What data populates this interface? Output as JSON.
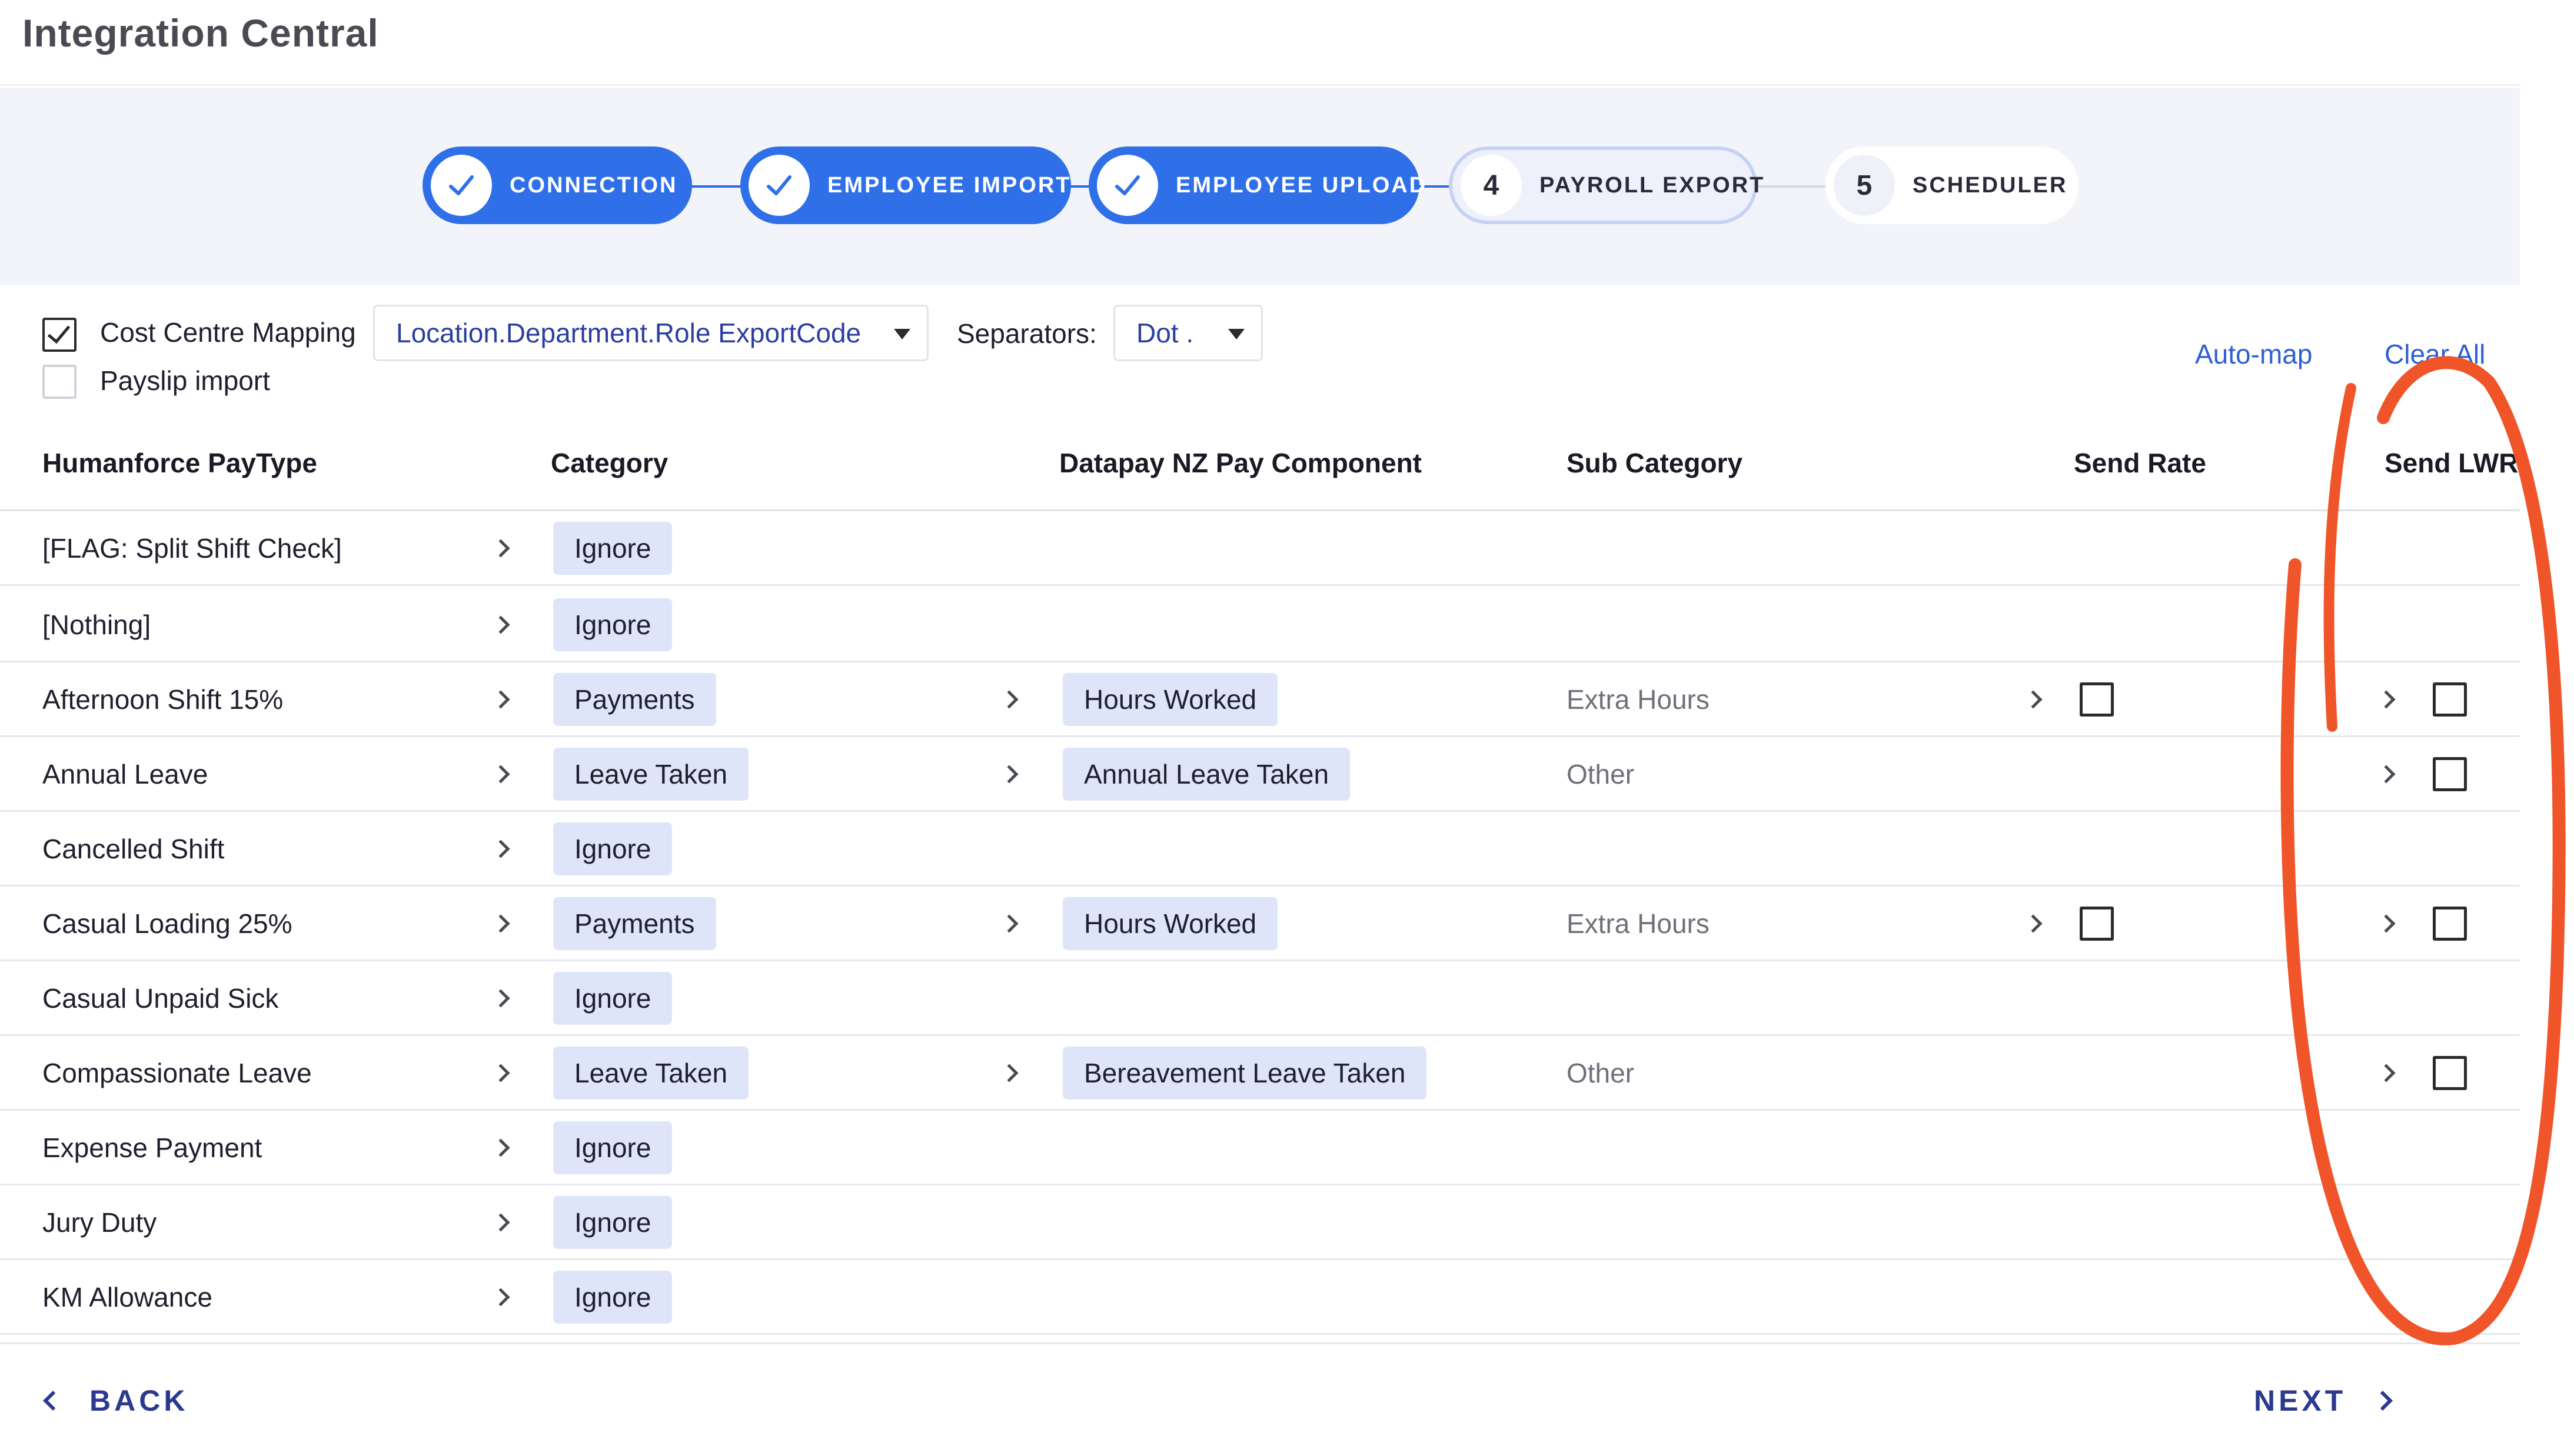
{
  "app": {
    "title": "Integration Central"
  },
  "stepper": {
    "steps": [
      {
        "label": "CONNECTION",
        "state": "done"
      },
      {
        "label": "EMPLOYEE IMPORT",
        "state": "done"
      },
      {
        "label": "EMPLOYEE UPLOAD",
        "state": "done"
      },
      {
        "number": "4",
        "label": "PAYROLL EXPORT",
        "state": "current"
      },
      {
        "number": "5",
        "label": "SCHEDULER",
        "state": "todo"
      }
    ]
  },
  "options": {
    "cost_centre_mapping": {
      "label": "Cost Centre Mapping",
      "checked": true
    },
    "payslip_import": {
      "label": "Payslip import",
      "checked": false
    },
    "mapping_select": {
      "value": "Location.Department.Role ExportCode"
    },
    "separators": {
      "label": "Separators:",
      "value": "Dot ."
    },
    "auto_map": "Auto-map",
    "clear_all": "Clear All"
  },
  "table": {
    "headers": {
      "paytype": "Humanforce PayType",
      "category": "Category",
      "component": "Datapay NZ Pay Component",
      "subcategory": "Sub Category",
      "send_rate": "Send Rate",
      "send_lwr": "Send LWR"
    },
    "rows": [
      {
        "paytype": "[FLAG: Split Shift Check]",
        "category": "Ignore"
      },
      {
        "paytype": "[Nothing]",
        "category": "Ignore"
      },
      {
        "paytype": "Afternoon Shift 15%",
        "category": "Payments",
        "component": "Hours Worked",
        "subcategory": "Extra Hours",
        "send_rate": false,
        "send_lwr": false
      },
      {
        "paytype": "Annual Leave",
        "category": "Leave Taken",
        "component": "Annual Leave Taken",
        "subcategory": "Other",
        "send_lwr": false
      },
      {
        "paytype": "Cancelled Shift",
        "category": "Ignore"
      },
      {
        "paytype": "Casual Loading 25%",
        "category": "Payments",
        "component": "Hours Worked",
        "subcategory": "Extra Hours",
        "send_rate": false,
        "send_lwr": false
      },
      {
        "paytype": "Casual Unpaid Sick",
        "category": "Ignore"
      },
      {
        "paytype": "Compassionate Leave",
        "category": "Leave Taken",
        "component": "Bereavement Leave Taken",
        "subcategory": "Other",
        "send_lwr": false
      },
      {
        "paytype": "Expense Payment",
        "category": "Ignore"
      },
      {
        "paytype": "Jury Duty",
        "category": "Ignore"
      },
      {
        "paytype": "KM Allowance",
        "category": "Ignore"
      }
    ]
  },
  "footer": {
    "back": "BACK",
    "next": "NEXT"
  },
  "colors": {
    "primary": "#2f70e8",
    "chip": "#dfe5f9",
    "annotation": "#f0552a",
    "nav": "#2b3a8f"
  }
}
